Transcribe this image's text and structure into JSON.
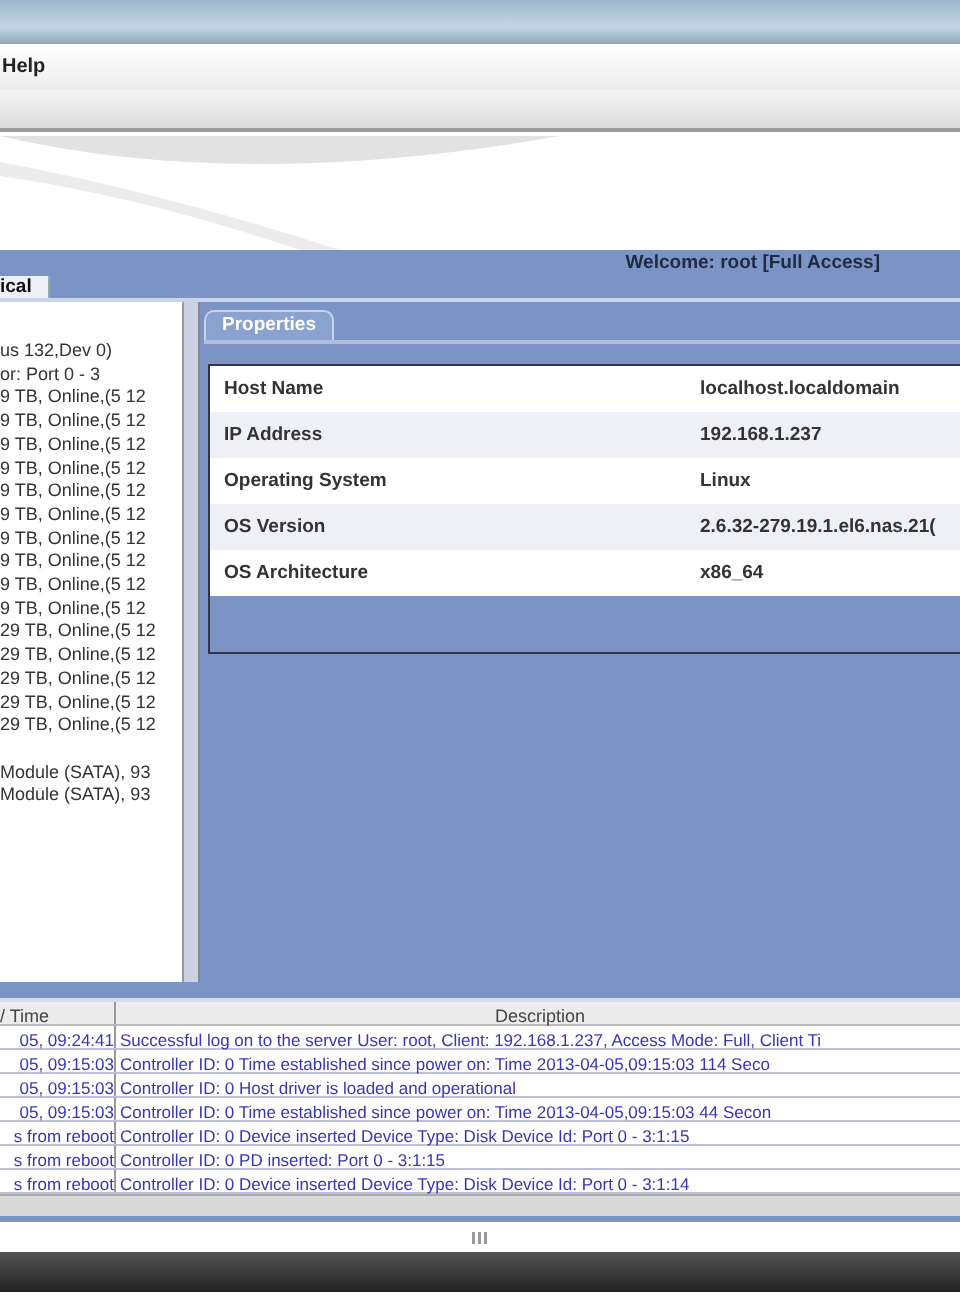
{
  "menu": [
    {
      "label": "Help"
    }
  ],
  "welcome": "Welcome: root [Full Access]",
  "view_tab": {
    "label": "ical",
    "selected": true
  },
  "tree": {
    "items": [
      "us 132,Dev 0)",
      "or: Port 0 - 3",
      "9 TB, Online,(5 12",
      "9 TB, Online,(5 12",
      "9 TB, Online,(5 12",
      "9 TB, Online,(5 12",
      "9 TB, Online,(5 12",
      "9 TB, Online,(5 12",
      "9 TB, Online,(5 12",
      "9 TB, Online,(5 12",
      "9 TB, Online,(5 12",
      "9 TB, Online,(5 12",
      "29 TB, Online,(5 12",
      "29 TB, Online,(5 12",
      "29 TB, Online,(5 12",
      "29 TB, Online,(5 12",
      "29 TB, Online,(5 12"
    ],
    "modules": [
      "Module (SATA), 93",
      "Module (SATA), 93"
    ]
  },
  "properties": {
    "tab": "Properties",
    "rows": [
      {
        "name": "Host Name",
        "value": "localhost.localdomain"
      },
      {
        "name": "IP Address",
        "value": "192.168.1.237"
      },
      {
        "name": "Operating System",
        "value": "Linux"
      },
      {
        "name": "OS Version",
        "value": "2.6.32-279.19.1.el6.nas.21("
      },
      {
        "name": "OS Architecture",
        "value": "x86_64"
      }
    ]
  },
  "log": {
    "columns": [
      "/ Time",
      "Description"
    ],
    "rows": [
      {
        "time": "05, 09:24:41",
        "description": "Successful log on to the server User: root, Client: 192.168.1.237, Access Mode: Full, Client Ti"
      },
      {
        "time": "05, 09:15:03",
        "description": "Controller ID: 0 Time established since power on: Time 2013-04-05,09:15:03 114 Seco"
      },
      {
        "time": "05, 09:15:03",
        "description": "Controller ID: 0 Host driver is loaded and operational"
      },
      {
        "time": "05, 09:15:03",
        "description": "Controller ID: 0 Time established since power on: Time 2013-04-05,09:15:03 44 Secon"
      },
      {
        "time": "s from reboot",
        "description": "Controller ID: 0 Device inserted Device Type: Disk Device Id: Port 0 - 3:1:15"
      },
      {
        "time": "s from reboot",
        "description": "Controller ID: 0 PD inserted: Port 0 - 3:1:15"
      },
      {
        "time": "s from reboot",
        "description": "Controller ID: 0 Device inserted Device Type: Disk Device Id: Port 0 - 3:1:14"
      }
    ]
  }
}
